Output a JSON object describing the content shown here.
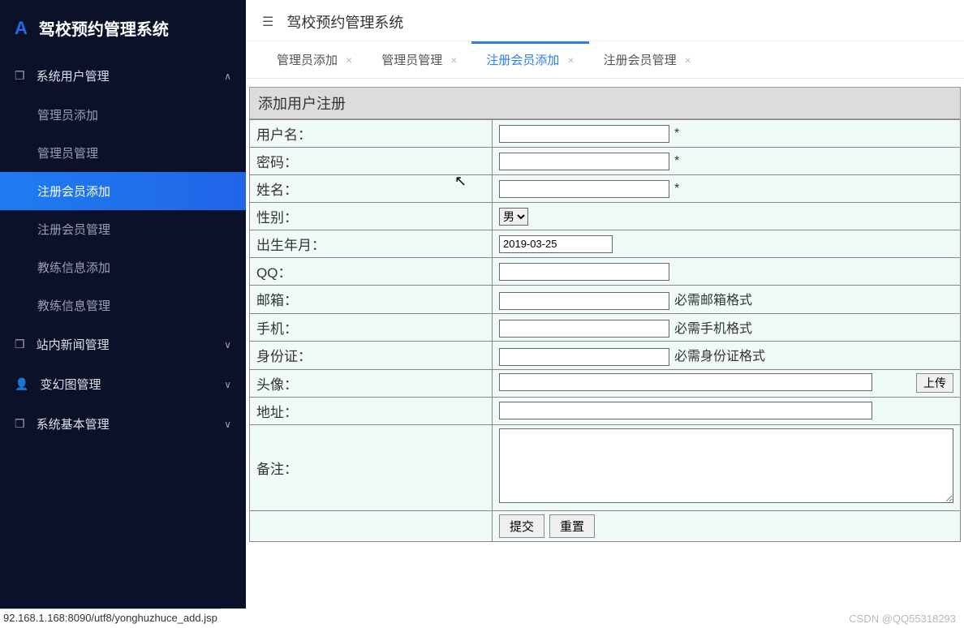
{
  "brand": {
    "title": "驾校预约管理系统"
  },
  "sidebar": {
    "groups": [
      {
        "label": "系统用户管理",
        "expanded": true,
        "items": [
          {
            "label": "管理员添加"
          },
          {
            "label": "管理员管理"
          },
          {
            "label": "注册会员添加"
          },
          {
            "label": "注册会员管理"
          },
          {
            "label": "教练信息添加"
          },
          {
            "label": "教练信息管理"
          }
        ]
      },
      {
        "label": "站内新闻管理",
        "expanded": false
      },
      {
        "label": "变幻图管理",
        "expanded": false
      },
      {
        "label": "系统基本管理",
        "expanded": false
      }
    ]
  },
  "header": {
    "title": "驾校预约管理系统"
  },
  "tabs": [
    {
      "label": "管理员添加",
      "active": false
    },
    {
      "label": "管理员管理",
      "active": false
    },
    {
      "label": "注册会员添加",
      "active": true
    },
    {
      "label": "注册会员管理",
      "active": false
    }
  ],
  "form": {
    "title": "添加用户注册",
    "fields": {
      "username": {
        "label": "用户名：",
        "required": "*"
      },
      "password": {
        "label": "密码：",
        "required": "*"
      },
      "name": {
        "label": "姓名：",
        "required": "*"
      },
      "gender": {
        "label": "性别：",
        "value": "男"
      },
      "dob": {
        "label": "出生年月：",
        "value": "2019-03-25"
      },
      "qq": {
        "label": "QQ："
      },
      "email": {
        "label": "邮箱：",
        "hint": "必需邮箱格式"
      },
      "phone": {
        "label": "手机：",
        "hint": "必需手机格式"
      },
      "idcard": {
        "label": "身份证：",
        "hint": "必需身份证格式"
      },
      "avatar": {
        "label": "头像：",
        "upload": "上传"
      },
      "address": {
        "label": "地址："
      },
      "remark": {
        "label": "备注："
      }
    },
    "buttons": {
      "submit": "提交",
      "reset": "重置"
    }
  },
  "statusbar": "92.168.1.168:8090/utf8/yonghuzhuce_add.jsp",
  "watermark": "CSDN @QQ55318293"
}
